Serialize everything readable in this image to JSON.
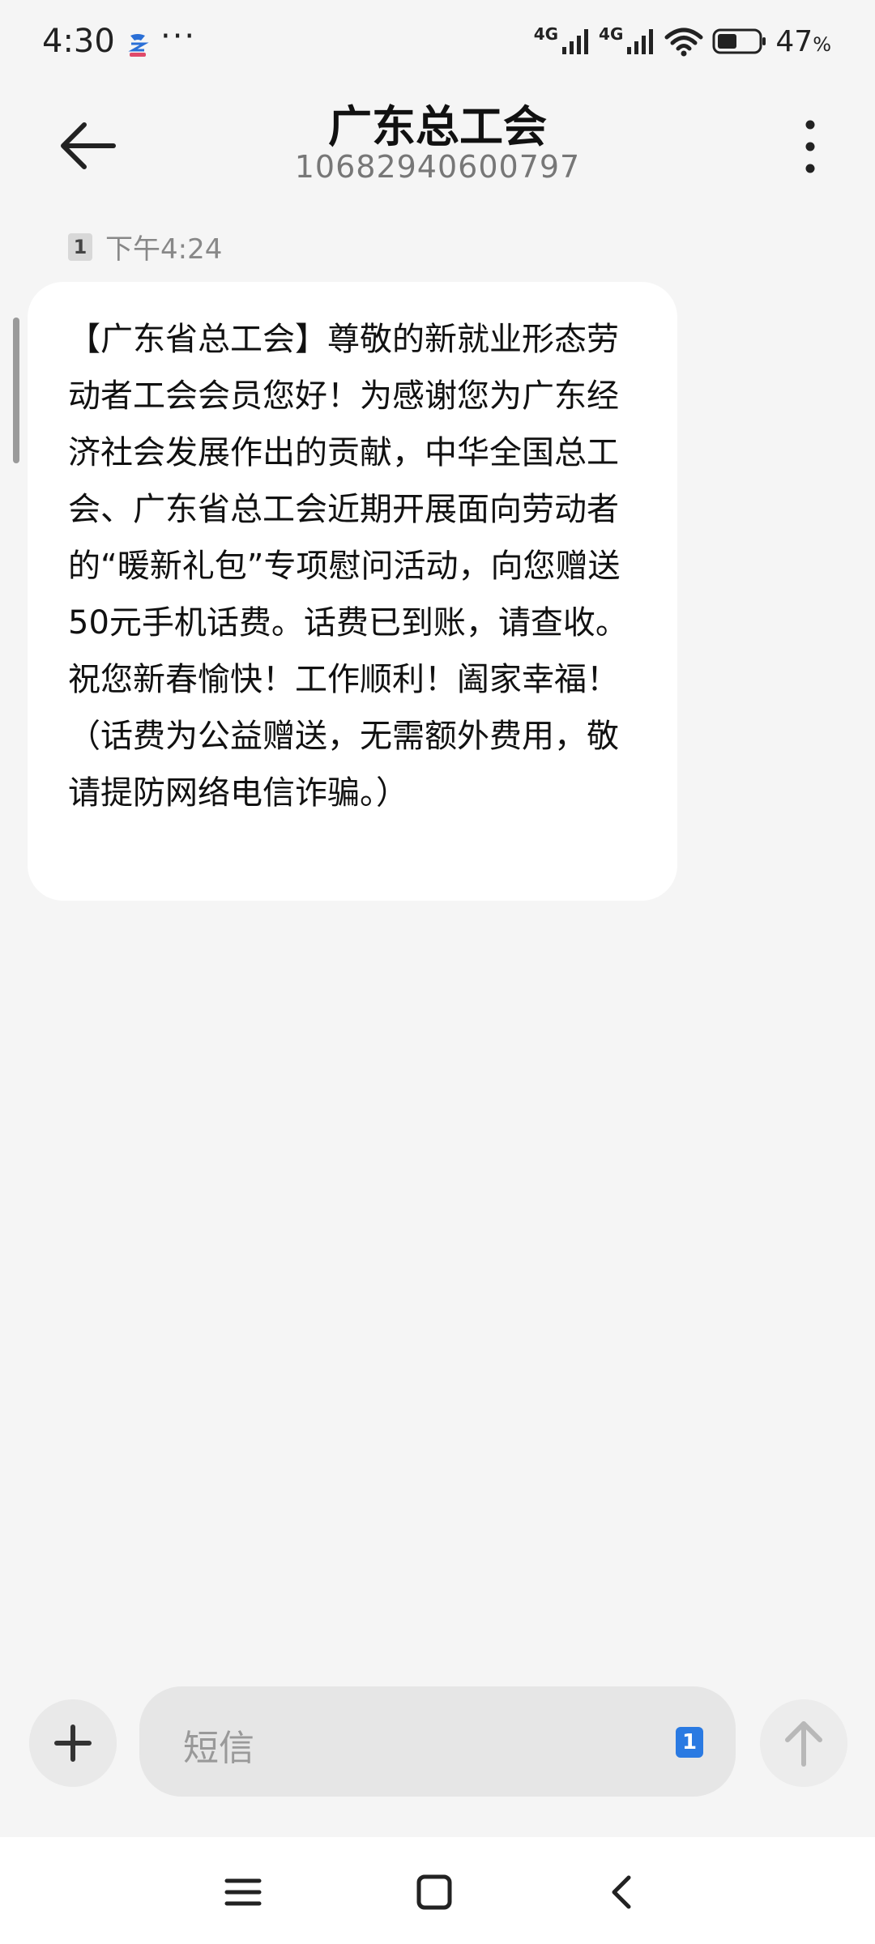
{
  "status_bar": {
    "time": "4:30",
    "more": "···",
    "net_label_1": "4G",
    "net_label_2": "4G",
    "battery_percent": "47",
    "battery_percent_sign": "%",
    "battery_level": 0.47
  },
  "header": {
    "title": "广东总工会",
    "subtitle": "10682940600797"
  },
  "message": {
    "sim_slot": "1",
    "time": "下午4:24",
    "text": "【广东省总工会】尊敬的新就业形态劳动者工会会员您好！为感谢您为广东经济社会发展作出的贡献，中华全国总工会、广东省总工会近期开展面向劳动者的“暖新礼包”专项慰问活动，向您赠送50元手机话费。话费已到账，请查收。祝您新春愉快！工作顺利！阖家幸福！（话费为公益赠送，无需额外费用，敬请提防网络电信诈骗。）"
  },
  "composer": {
    "placeholder": "短信",
    "sim_slot": "1"
  },
  "icons": {
    "back": "arrow-left-icon",
    "menu": "more-vertical-icon",
    "add": "plus-icon",
    "send": "arrow-up-icon",
    "nav_menu": "hamburger-icon",
    "nav_home": "square-icon",
    "nav_back": "chevron-left-icon"
  },
  "colors": {
    "background": "#f5f5f5",
    "bubble": "#ffffff",
    "sim_chip": "#2a7ae2"
  }
}
